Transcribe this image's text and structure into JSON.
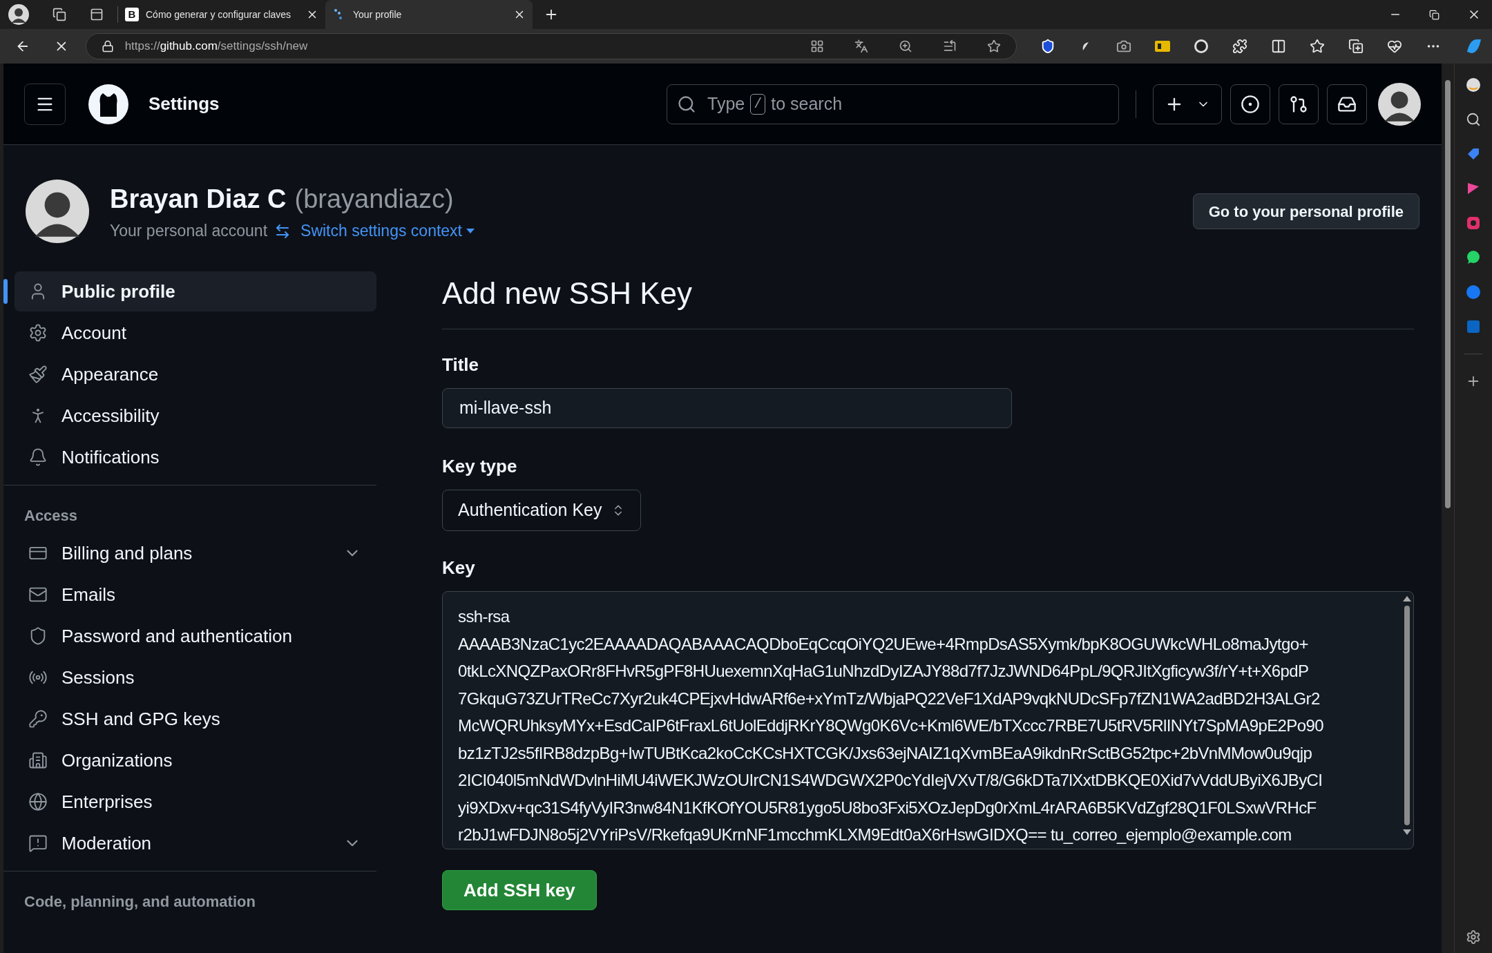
{
  "browser": {
    "tabs": [
      {
        "title": "Cómo generar y configurar claves",
        "favicon": "B",
        "kind": "page",
        "selected": false
      },
      {
        "title": "Your profile",
        "kind": "loading",
        "selected": true
      }
    ],
    "url": {
      "scheme": "https://",
      "domain": "github.com",
      "path": "/settings/ssh/new"
    }
  },
  "header": {
    "title": "Settings",
    "search": {
      "prefix": "Type",
      "key": "/",
      "suffix": "to search"
    }
  },
  "profile": {
    "name": "Brayan Diaz C",
    "handle": "(brayandiazc)",
    "subtitle": "Your personal account",
    "switch_label": "Switch settings context",
    "profile_button": "Go to your personal profile"
  },
  "sidebar": {
    "groups": [
      {
        "items": [
          {
            "label": "Public profile",
            "selected": true,
            "expandable": false
          },
          {
            "label": "Account",
            "selected": false,
            "expandable": false
          },
          {
            "label": "Appearance",
            "selected": false,
            "expandable": false
          },
          {
            "label": "Accessibility",
            "selected": false,
            "expandable": false
          },
          {
            "label": "Notifications",
            "selected": false,
            "expandable": false
          }
        ]
      },
      {
        "heading": "Access",
        "items": [
          {
            "label": "Billing and plans",
            "selected": false,
            "expandable": true
          },
          {
            "label": "Emails",
            "selected": false,
            "expandable": false
          },
          {
            "label": "Password and authentication",
            "selected": false,
            "expandable": false
          },
          {
            "label": "Sessions",
            "selected": false,
            "expandable": false
          },
          {
            "label": "SSH and GPG keys",
            "selected": false,
            "expandable": false
          },
          {
            "label": "Organizations",
            "selected": false,
            "expandable": false
          },
          {
            "label": "Enterprises",
            "selected": false,
            "expandable": false
          },
          {
            "label": "Moderation",
            "selected": false,
            "expandable": true
          }
        ]
      },
      {
        "heading": "Code, planning, and automation"
      }
    ]
  },
  "main": {
    "title": "Add new SSH Key",
    "title_field": {
      "label": "Title",
      "value": "mi-llave-ssh"
    },
    "key_type": {
      "label": "Key type",
      "value": "Authentication Key"
    },
    "key_field": {
      "label": "Key",
      "lines": [
        "ssh-rsa",
        "AAAAB3NzaC1yc2EAAAADAQABAAACAQDboEqCcqOiYQ2UEwe+4RmpDsAS5Xymk/bpK8OGUWkcWHLo8maJytgo+",
        "0tkLcXNQZPaxORr8FHvR5gPF8HUuexemnXqHaG1uNhzdDyIZAJY88d7f7JzJWND64PpL/9QRJItXgficyw3f/rY+t+X6pdP",
        "7GkquG73ZUrTReCc7Xyr2uk4CPEjxvHdwARf6e+xYmTz/WbjaPQ22VeF1XdAP9vqkNUDcSFp7fZN1WA2adBD2H3ALGr2",
        "McWQRUhksyMYx+EsdCaIP6tFraxL6tUolEddjRKrY8QWg0K6Vc+Kml6WE/bTXccc7RBE7U5tRV5RlINYt7SpMA9pE2Po90",
        "bz1zTJ2s5fIRB8dzpBg+IwTUBtKca2koCcKCsHXTCGK/Jxs63ejNAIZ1qXvmBEaA9ikdnRrSctBG52tpc+2bVnMMow0u9qjp",
        "2ICI040l5mNdWDvlnHiMU4iWEKJWzOUIrCN1S4WDGWX2P0cYdIejVXvT/8/G6kDTa7lXxtDBKQE0Xid7vVddUByiX6JByCI",
        "yi9XDxv+qc31S4fyVyIR3nw84N1KfKOfYOU5R81ygo5U8bo3Fxi5XOzJepDg0rXmL4rARA6B5KVdZgf28Q1F0LSxwVRHcF",
        "r2bJ1wFDJN8o5j2VYriPsV/Rkefqa9UKrnNF1mcchmKLXM9Edt0aX6rHswGIDXQ== tu_correo_ejemplo@example.com"
      ]
    },
    "submit": "Add SSH key"
  }
}
